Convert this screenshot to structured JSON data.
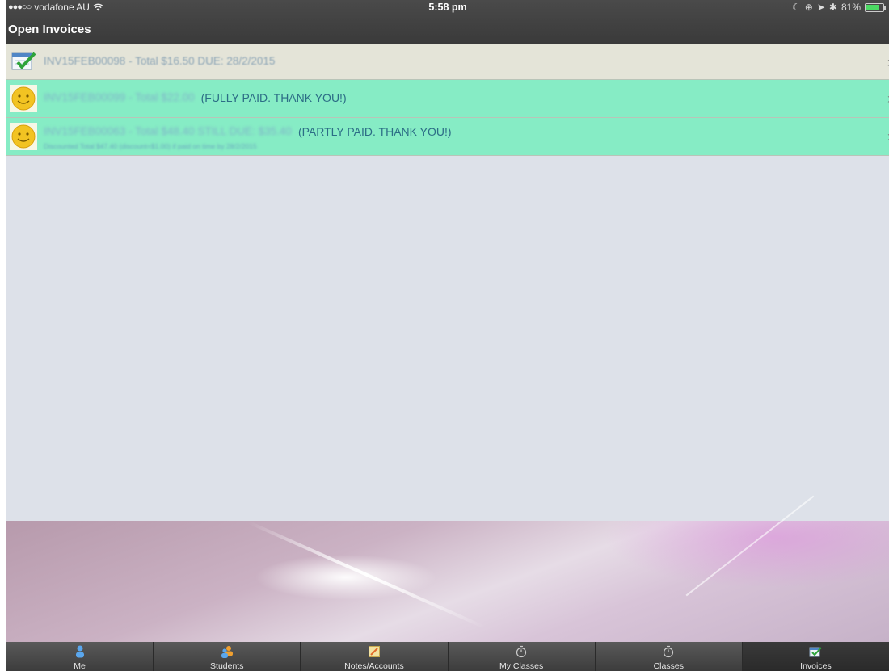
{
  "status_bar": {
    "signal": "●●●○○",
    "carrier": "vodafone AU",
    "time": "5:58 pm",
    "battery": "81%",
    "battery_level": 0.81
  },
  "header": {
    "title": "Open Invoices"
  },
  "invoices": [
    {
      "status": "unpaid",
      "icon": "calendar-check-icon",
      "text": "INV15FEB00098 - Total $16.50  DUE: 28/2/2015",
      "note": "",
      "sub": ""
    },
    {
      "status": "paid",
      "icon": "smiley-icon",
      "text": "INV15FEB00099 - Total $22.00",
      "note": "(FULLY PAID. THANK YOU!)",
      "sub": ""
    },
    {
      "status": "partial",
      "icon": "smiley-icon",
      "text": "INV15FEB00063 - Total $48.40 STILL DUE: $35.40",
      "note": "(PARTLY PAID. THANK YOU!)",
      "sub": "Discounted Total $47.40 (discount=$1.00) if paid on time by 28/2/2015"
    }
  ],
  "tabs": [
    {
      "label": "Me",
      "icon": "person-icon",
      "active": false
    },
    {
      "label": "Students",
      "icon": "students-icon",
      "active": false
    },
    {
      "label": "Notes/Accounts",
      "icon": "notes-icon",
      "active": false
    },
    {
      "label": "My Classes",
      "icon": "stopwatch-icon",
      "active": false
    },
    {
      "label": "Classes",
      "icon": "stopwatch-icon",
      "active": false
    },
    {
      "label": "Invoices",
      "icon": "invoice-icon",
      "active": true
    }
  ],
  "colors": {
    "paid_row": "#86ecc5",
    "unpaid_row": "#e4e4d8",
    "background": "#dde1e9",
    "header": "#3f3f3f"
  }
}
